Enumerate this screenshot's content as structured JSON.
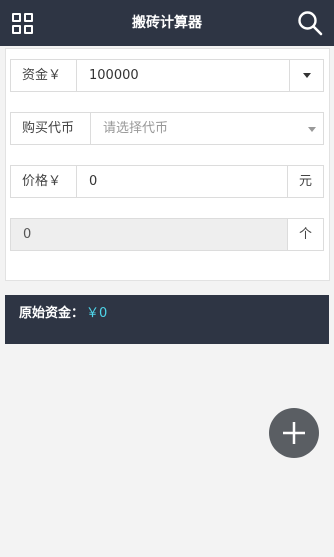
{
  "header": {
    "title": "搬砖计算器",
    "menu_icon": "grid-icon",
    "search_icon": "search-icon"
  },
  "form": {
    "capital": {
      "label": "资金￥",
      "value": "100000"
    },
    "coin": {
      "label": "购买代币",
      "placeholder": "请选择代币"
    },
    "price": {
      "label": "价格￥",
      "value": "0",
      "unit": "元"
    },
    "result": {
      "value": "0",
      "unit": "个"
    }
  },
  "summary": {
    "label": "原始资金：",
    "amount": "￥0"
  },
  "colors": {
    "header_bg": "#2e3544",
    "summary_bg": "#2e3544",
    "accent": "#4fd6ea",
    "fab_bg": "#5a5e63"
  },
  "fab": {
    "icon": "plus-icon"
  }
}
